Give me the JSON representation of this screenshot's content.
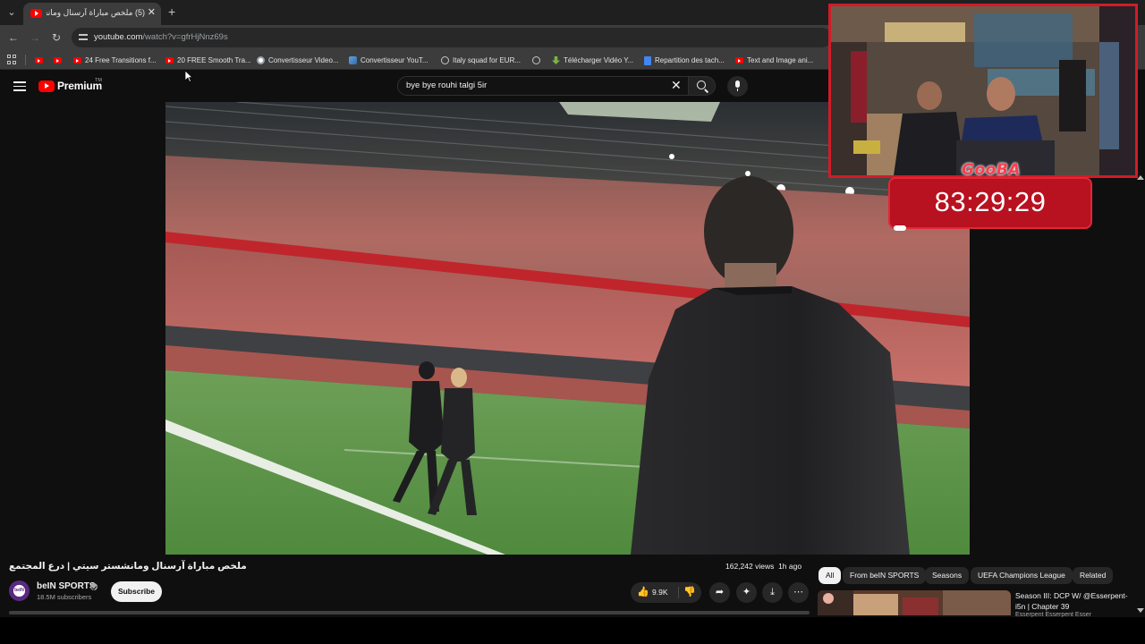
{
  "browser": {
    "tab": {
      "title": "(5) ملخص مباراة آرسنال ومانشستر سيتي | درع المجتمع",
      "close_glyph": "✕"
    },
    "tab_list_glyph": "⌄",
    "new_tab_glyph": "+",
    "nav": {
      "back_glyph": "←",
      "forward_glyph": "→",
      "reload_glyph": "↻"
    },
    "url": {
      "host": "youtube.com",
      "path": "/watch?v=gfrHjNnz69s"
    },
    "bookmarks": [
      {
        "icon": "youtube-icon",
        "label": ""
      },
      {
        "icon": "youtube-icon",
        "label": ""
      },
      {
        "icon": "youtube-icon",
        "label": "24 Free Transitions f..."
      },
      {
        "icon": "youtube-icon",
        "label": "20 FREE Smooth Tra..."
      },
      {
        "icon": "chrome-icon",
        "label": "Convertisseur Video..."
      },
      {
        "icon": "layers-icon",
        "label": "Convertisseur YouT..."
      },
      {
        "icon": "globe-icon",
        "label": "Italy squad for EUR..."
      },
      {
        "icon": "globe-icon",
        "label": ""
      },
      {
        "icon": "download-arrow-icon",
        "label": "Télécharger Vidéo Y..."
      },
      {
        "icon": "docs-icon",
        "label": "Repartition des tach..."
      },
      {
        "icon": "youtube-icon",
        "label": "Text and Image ani..."
      }
    ]
  },
  "youtube": {
    "logo_text": "Premium",
    "logo_tm": "TM",
    "search": {
      "value": "bye bye rouhi talgi 5ir",
      "clear_glyph": "✕"
    }
  },
  "stream_overlay": {
    "timer_name": "GooBA",
    "timer_value": "83:29:29"
  },
  "video": {
    "title": "ملخص مباراة آرسنال ومانشستر سيتي | درع المجتمع",
    "views": "162,242 views",
    "age": "1h ago",
    "channel": {
      "name": "beIN SPORTS",
      "subscribers": "18.5M subscribers",
      "avatar_text": "beIN"
    },
    "subscribe_label": "Subscribe",
    "likes": "9.9K",
    "action_glyphs": {
      "like": "👍",
      "dislike": "👎",
      "share": "➦",
      "ask": "✦",
      "download": "⤓",
      "more": "⋯"
    }
  },
  "related": {
    "chips": [
      "All",
      "From beIN SPORTS",
      "Seasons",
      "UEFA Champions League",
      "Related"
    ],
    "active_chip": "All",
    "items": [
      {
        "title": "Season III: DCP W/ @Esserpent-i5n | Chapter 39",
        "channel": "Esserpent Esserpent Esser"
      }
    ]
  },
  "colors": {
    "youtube_red": "#ff0000",
    "overlay_red": "#b8111f",
    "page_background": "#0f0f0f"
  }
}
